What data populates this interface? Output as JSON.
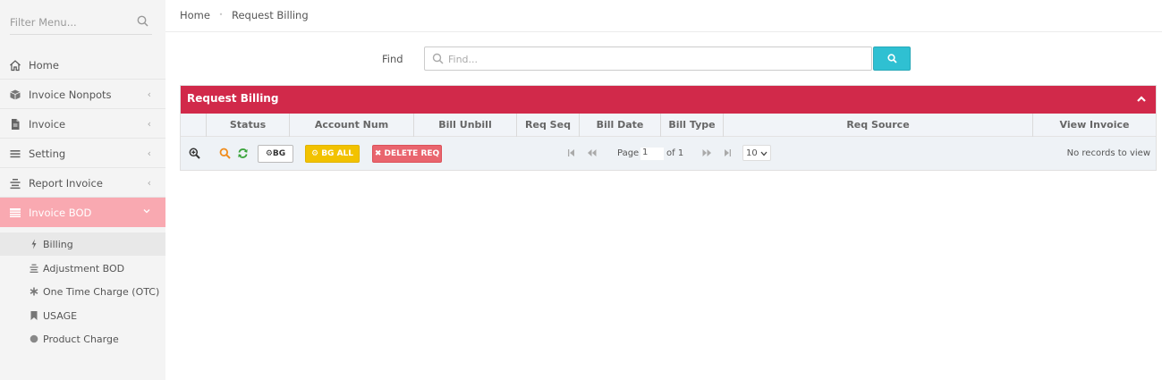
{
  "sidebar": {
    "filter_placeholder": "Filter Menu...",
    "items": [
      {
        "label": "Home",
        "icon": "home-icon"
      },
      {
        "label": "Invoice Nonpots",
        "icon": "cube-icon",
        "chevron": "‹"
      },
      {
        "label": "Invoice",
        "icon": "file-icon",
        "chevron": "‹"
      },
      {
        "label": "Setting",
        "icon": "bars-icon",
        "chevron": "‹"
      },
      {
        "label": "Report Invoice",
        "icon": "report-icon",
        "chevron": "‹"
      },
      {
        "label": "Invoice BOD",
        "icon": "table-icon",
        "chevron": "⌄",
        "active": true
      }
    ],
    "subitems": [
      {
        "label": "Billing",
        "icon": "bolt-icon",
        "active": true
      },
      {
        "label": "Adjustment BOD",
        "icon": "report-icon"
      },
      {
        "label": "One Time Charge (OTC)",
        "icon": "asterisk-icon"
      },
      {
        "label": "USAGE",
        "icon": "bookmark-icon"
      },
      {
        "label": "Product Charge",
        "icon": "circle-icon"
      }
    ]
  },
  "breadcrumb": {
    "home": "Home",
    "sep": "•",
    "current": "Request Billing"
  },
  "search": {
    "label": "Find",
    "placeholder": "Find..."
  },
  "grid": {
    "caption": "Request Billing",
    "columns": [
      "Status",
      "Account Num",
      "Bill Unbill",
      "Req Seq",
      "Bill Date",
      "Bill Type",
      "Req Source",
      "View Invoice"
    ],
    "rows": [],
    "buttons": {
      "bg": "BG",
      "bg_all": "BG ALL",
      "delete_req": "DELETE REQ"
    },
    "pager": {
      "page_label": "Page",
      "page_value": "1",
      "of_label": "of 1",
      "rows_per_page": "10",
      "records_text": "No records to view"
    }
  },
  "colors": {
    "accent": "#d1294a",
    "sidebar_active": "#f9a9b1",
    "find_button": "#2fc0d2",
    "bg_all": "#f2c200",
    "delete": "#e9656e"
  }
}
